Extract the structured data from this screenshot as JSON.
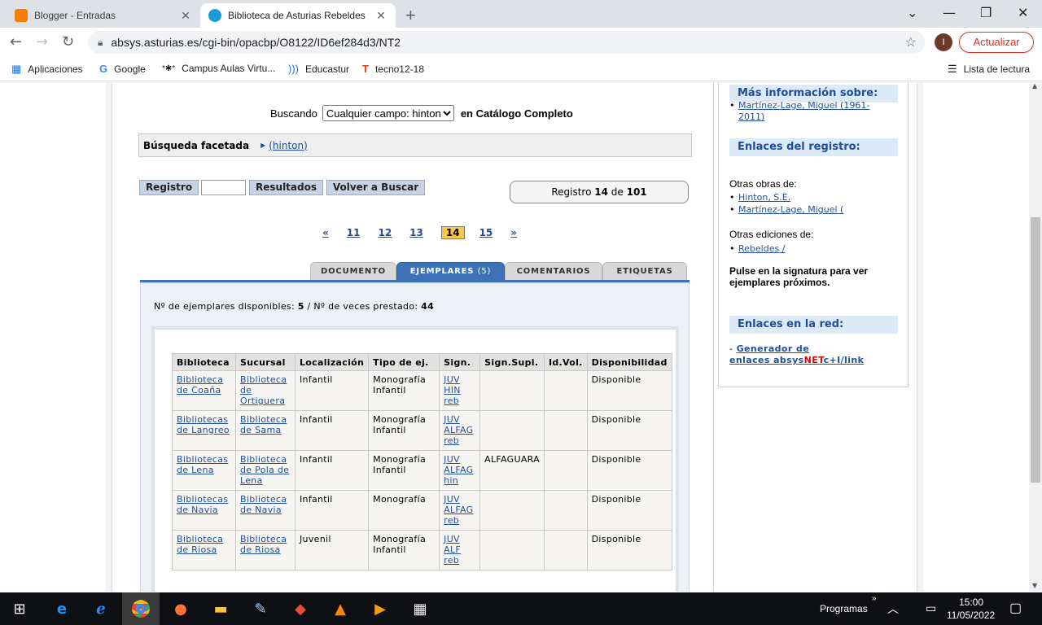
{
  "browser": {
    "tabs": [
      {
        "title": "Blogger - Entradas",
        "favicon_color": "#f57d00"
      },
      {
        "title": "Biblioteca de Asturias Rebeldes",
        "favicon_color": "#1a9bd7"
      }
    ],
    "url": "absys.asturias.es/cgi-bin/opacbp/O8122/ID6ef284d3/NT2",
    "profile_initial": "I",
    "update_label": "Actualizar",
    "bookmarks": [
      {
        "label": "Aplicaciones",
        "icon": "apps-grid-icon"
      },
      {
        "label": "Google",
        "icon": "google-icon"
      },
      {
        "label": "Campus Aulas Virtu...",
        "icon": "campus-icon"
      },
      {
        "label": "Educastur",
        "icon": "educastur-icon"
      },
      {
        "label": "tecno12-18",
        "icon": "tecno-icon"
      }
    ],
    "reading_list": "Lista de lectura"
  },
  "search": {
    "label": "Buscando",
    "field": "Cualquier campo: hinton/",
    "catalog": "en Catálogo Completo"
  },
  "facet": {
    "label": "Búsqueda facetada",
    "term": "(hinton)"
  },
  "nav": {
    "registro": "Registro",
    "resultados": "Resultados",
    "volver": "Volver a Buscar",
    "count_prefix": "Registro",
    "current": "14",
    "count_mid": "de",
    "total": "101"
  },
  "pager": {
    "first": "«",
    "pages": [
      "11",
      "12",
      "13",
      "14",
      "15"
    ],
    "current": "14",
    "last": "»"
  },
  "tabs": [
    {
      "label": "DOCUMENTO",
      "active": false
    },
    {
      "label": "EJEMPLARES",
      "count": "(5)",
      "active": true
    },
    {
      "label": "COMENTARIOS",
      "active": false
    },
    {
      "label": "ETIQUETAS",
      "active": false
    }
  ],
  "availability": {
    "text1": "Nº de ejemplares disponibles:",
    "available": "5",
    "sep": "/",
    "text2": "Nº de veces prestado:",
    "loans": "44"
  },
  "table": {
    "headers": [
      "Biblioteca",
      "Sucursal",
      "Localización",
      "Tipo de ej.",
      "Sign.",
      "Sign.Supl.",
      "Id.Vol.",
      "Disponibilidad"
    ],
    "rows": [
      {
        "biblioteca": "Biblioteca de Coaña",
        "sucursal": "Biblioteca de Ortiguera",
        "localizacion": "Infantil",
        "tipo": "Monografía Infantil",
        "sign": "JUV HIN reb",
        "supl": "",
        "vol": "",
        "disp": "Disponible"
      },
      {
        "biblioteca": "Bibliotecas de Langreo",
        "sucursal": "Biblioteca de Sama",
        "localizacion": "Infantil",
        "tipo": "Monografía Infantil",
        "sign": "JUV ALFAG reb",
        "supl": "",
        "vol": "",
        "disp": "Disponible"
      },
      {
        "biblioteca": "Bibliotecas de Lena",
        "sucursal": "Biblioteca de Pola de Lena",
        "localizacion": "Infantil",
        "tipo": "Monografía Infantil",
        "sign": "JUV ALFAG hin",
        "supl": "ALFAGUARA",
        "vol": "",
        "disp": "Disponible"
      },
      {
        "biblioteca": "Bibliotecas de Navia",
        "sucursal": "Biblioteca de Navia",
        "localizacion": "Infantil",
        "tipo": "Monografía",
        "sign": "JUV ALFAG reb",
        "supl": "",
        "vol": "",
        "disp": "Disponible"
      },
      {
        "biblioteca": "Biblioteca de Riosa",
        "sucursal": "Biblioteca de Riosa",
        "localizacion": "Juvenil",
        "tipo": "Monografía Infantil",
        "sign": "JUV ALF reb",
        "supl": "",
        "vol": "",
        "disp": "Disponible"
      }
    ]
  },
  "sidebar": {
    "mas_info_title": "Más información sobre:",
    "mas_info_links": [
      "Martínez-Lage, Miguel (1961-",
      "2011)"
    ],
    "enlaces_registro_title": "Enlaces del registro:",
    "otras_obras_label": "Otras obras de:",
    "otras_obras": [
      "Hinton, S.E.",
      "Martínez-Lage, Miguel ("
    ],
    "otras_ediciones_label": "Otras ediciones de:",
    "otras_ediciones": [
      "Rebeldes /"
    ],
    "signatura_note": "Pulse en la signatura para ver ejemplares próximos.",
    "enlaces_red_title": "Enlaces en la red:",
    "generador_prefix": "-",
    "generador_1": "Generador de",
    "generador_2": "enlaces absys",
    "generador_net": "NET",
    "generador_3": "c+I/link"
  },
  "taskbar": {
    "programs_label": "Programas",
    "time": "15:00",
    "date": "11/05/2022"
  }
}
